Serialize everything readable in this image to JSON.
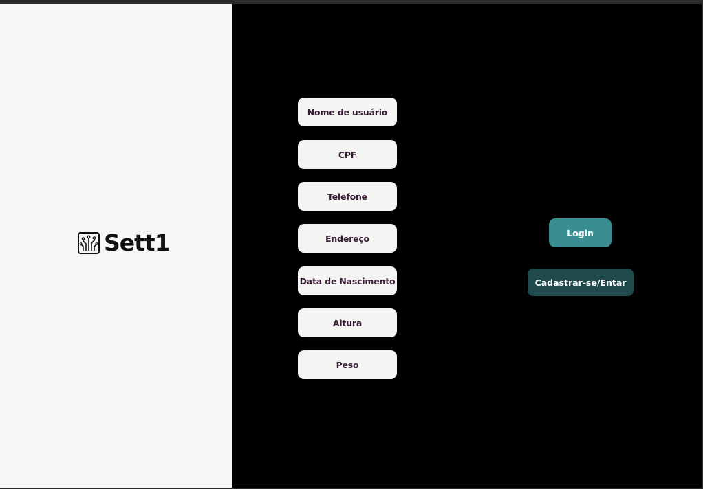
{
  "brand": {
    "name": "Sett1",
    "icon": "circuit-tree-icon"
  },
  "form": {
    "fields": [
      {
        "label": "Nome de usuário"
      },
      {
        "label": "CPF"
      },
      {
        "label": "Telefone"
      },
      {
        "label": "Endereço"
      },
      {
        "label": "Data de Nascimento"
      },
      {
        "label": "Altura"
      },
      {
        "label": "Peso"
      }
    ]
  },
  "actions": {
    "login_label": "Login",
    "register_label": "Cadastrar-se/Entar"
  },
  "colors": {
    "left_panel": "#f6f6f6",
    "right_panel": "#000000",
    "field_bg": "#f4f4f2",
    "field_text": "#3a1e37",
    "login_bg": "#3a8d91",
    "register_bg": "#1e4a4d"
  }
}
